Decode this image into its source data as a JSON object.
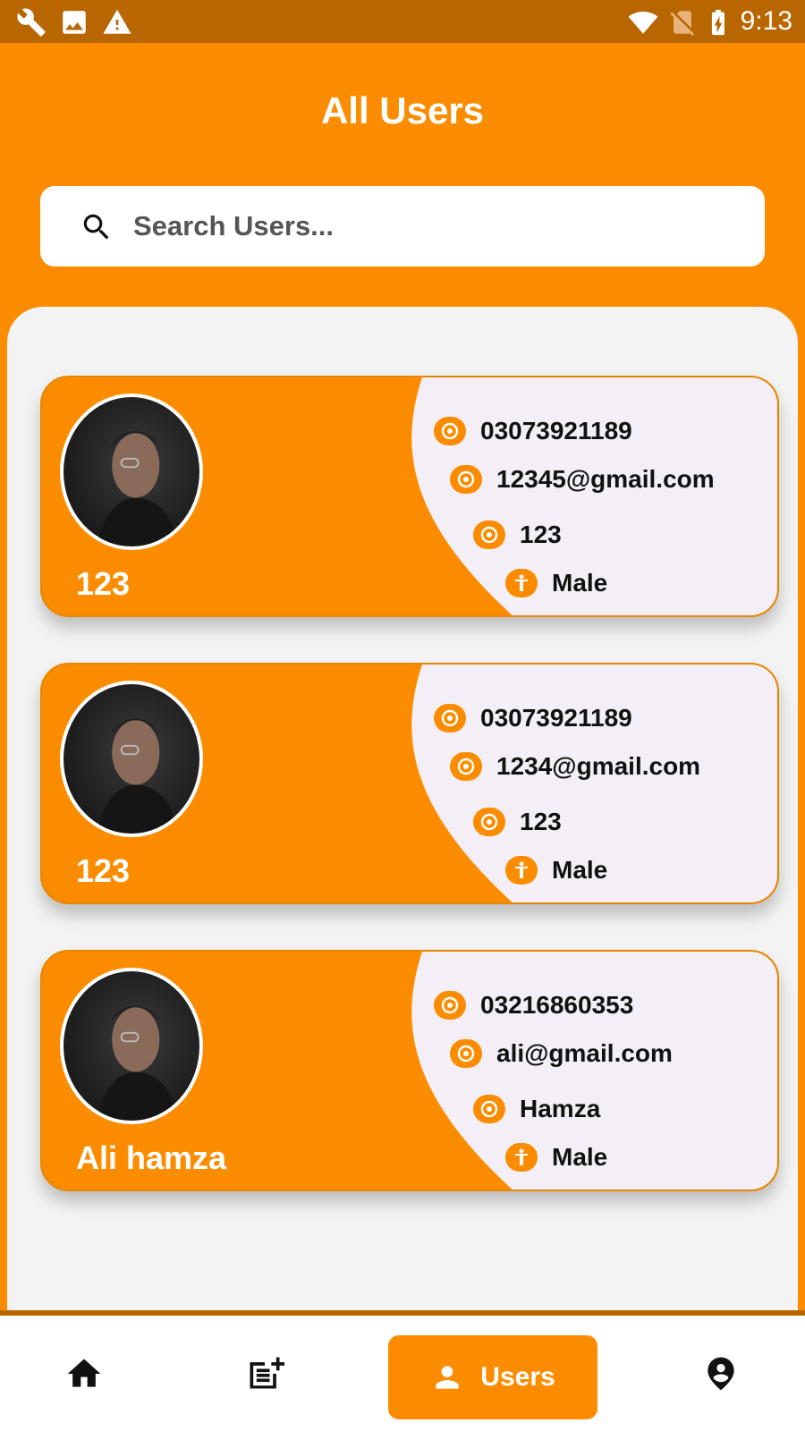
{
  "status_bar": {
    "time": "9:13",
    "left_icons": [
      "wrench-icon",
      "image-icon",
      "warning-icon"
    ],
    "right_icons": [
      "wifi-icon",
      "no-sim-icon",
      "battery-charging-icon"
    ]
  },
  "header": {
    "title": "All Users"
  },
  "search": {
    "placeholder": "Search Users...",
    "value": ""
  },
  "users": [
    {
      "name": "123",
      "phone": "03073921189",
      "email": "12345@gmail.com",
      "detail": "123",
      "gender": "Male"
    },
    {
      "name": "123",
      "phone": "03073921189",
      "email": "1234@gmail.com",
      "detail": "123",
      "gender": "Male"
    },
    {
      "name": "Ali hamza",
      "phone": "03216860353",
      "email": "ali@gmail.com",
      "detail": "Hamza",
      "gender": "Male"
    }
  ],
  "bottom_nav": {
    "items": [
      {
        "icon": "home-icon",
        "label": ""
      },
      {
        "icon": "post-add-icon",
        "label": ""
      },
      {
        "icon": "person-icon",
        "label": "Users",
        "active": true
      },
      {
        "icon": "person-pin-icon",
        "label": ""
      }
    ]
  },
  "colors": {
    "primary": "#fb8c00",
    "status_bar": "#b86700",
    "card_light": "#f4eff6",
    "panel": "#f3f3f3"
  }
}
